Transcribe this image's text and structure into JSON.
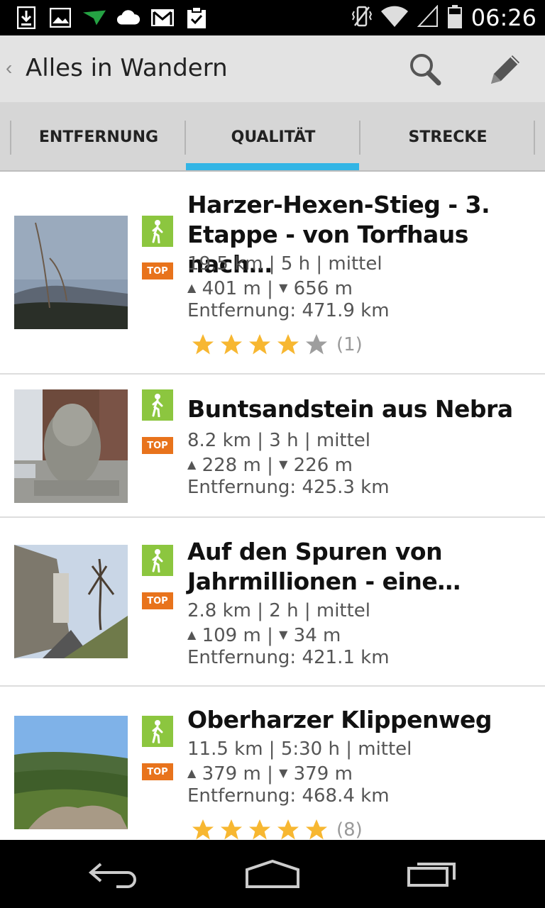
{
  "status_bar": {
    "time": "06:26",
    "icons_left": [
      "download-icon",
      "image-icon",
      "navigation-icon",
      "cloud-icon",
      "gmail-icon",
      "clipboard-icon"
    ],
    "icons_right": [
      "vibrate-icon",
      "wifi-icon",
      "signal-icon",
      "battery-icon"
    ]
  },
  "action_bar": {
    "back_glyph": "‹",
    "title": "Alles in Wandern"
  },
  "tabs": [
    {
      "label": "ENTFERNUNG",
      "selected": false
    },
    {
      "label": "QUALITÄT",
      "selected": true
    },
    {
      "label": "STRECKE",
      "selected": false
    }
  ],
  "colors": {
    "accent": "#33b5e5",
    "hike_badge": "#8cc63f",
    "top_badge": "#e8731c",
    "star_on": "#f7b731",
    "star_off": "#9e9e9e"
  },
  "top_label": "TOP",
  "up_glyph": "▲",
  "down_glyph": "▼",
  "items": [
    {
      "title": "Harzer-Hexen-Stieg - 3. Etappe - von Torfhaus nach…",
      "stats": "19.5 km | 5 h | mittel",
      "ascent": "401 m",
      "descent": "656 m",
      "sep": "|",
      "distance": "Entfernung: 471.9 km",
      "rating": 4,
      "rating_count": "(1)"
    },
    {
      "title": "Buntsandstein aus Nebra",
      "stats": "8.2 km | 3 h | mittel",
      "ascent": "228 m",
      "descent": "226 m",
      "sep": "|",
      "distance": "Entfernung: 425.3 km"
    },
    {
      "title": "Auf den Spuren von Jahrmillionen - eine…",
      "stats": "2.8 km | 2 h | mittel",
      "ascent": "109 m",
      "descent": "34 m",
      "sep": "|",
      "distance": "Entfernung: 421.1 km"
    },
    {
      "title": "Oberharzer Klippenweg",
      "stats": "11.5 km | 5:30 h | mittel",
      "ascent": "379 m",
      "descent": "379 m",
      "sep": "|",
      "distance": "Entfernung: 468.4 km",
      "rating": 5,
      "rating_count": "(8)"
    }
  ],
  "nav_bar": [
    "back-icon",
    "home-icon",
    "recents-icon"
  ]
}
